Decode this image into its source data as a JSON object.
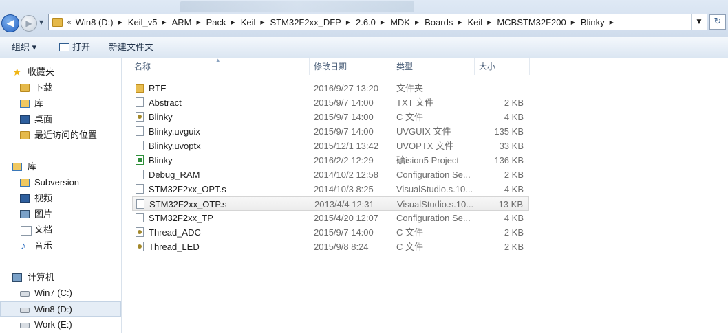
{
  "address": {
    "chevron": "«",
    "crumbs": [
      "Win8 (D:)",
      "Keil_v5",
      "ARM",
      "Pack",
      "Keil",
      "STM32F2xx_DFP",
      "2.6.0",
      "MDK",
      "Boards",
      "Keil",
      "MCBSTM32F200",
      "Blinky"
    ],
    "refresh_icon": "↻"
  },
  "toolbar": {
    "organize": "组织 ▾",
    "open": "打开",
    "new_folder": "新建文件夹"
  },
  "nav": {
    "favorites": {
      "label": "收藏夹",
      "icon": "star-icon",
      "items": [
        "下载",
        "库",
        "桌面",
        "最近访问的位置"
      ]
    },
    "libraries": {
      "label": "库",
      "items": [
        "Subversion",
        "视频",
        "图片",
        "文档",
        "音乐"
      ]
    },
    "computer": {
      "label": "计算机",
      "items": [
        "Win7 (C:)",
        "Win8 (D:)",
        "Work (E:)"
      ]
    }
  },
  "columns": {
    "name": "名称",
    "date": "修改日期",
    "type": "类型",
    "size": "大小"
  },
  "files": [
    {
      "name": "RTE",
      "date": "2016/9/27 13:20",
      "type": "文件夹",
      "size": "",
      "icon": "folder-icon"
    },
    {
      "name": "Abstract",
      "date": "2015/9/7 14:00",
      "type": "TXT 文件",
      "size": "2 KB",
      "icon": "text-file-icon"
    },
    {
      "name": "Blinky",
      "date": "2015/9/7 14:00",
      "type": "C 文件",
      "size": "4 KB",
      "icon": "c-file-icon"
    },
    {
      "name": "Blinky.uvguix",
      "date": "2015/9/7 14:00",
      "type": "UVGUIX 文件",
      "size": "135 KB",
      "icon": "generic-file-icon"
    },
    {
      "name": "Blinky.uvoptx",
      "date": "2015/12/1 13:42",
      "type": "UVOPTX 文件",
      "size": "33 KB",
      "icon": "generic-file-icon"
    },
    {
      "name": "Blinky",
      "date": "2016/2/2 12:29",
      "type": "礦ision5 Project",
      "size": "136 KB",
      "icon": "uvision-project-icon"
    },
    {
      "name": "Debug_RAM",
      "date": "2014/10/2 12:58",
      "type": "Configuration Se...",
      "size": "2 KB",
      "icon": "generic-file-icon"
    },
    {
      "name": "STM32F2xx_OPT.s",
      "date": "2014/10/3 8:25",
      "type": "VisualStudio.s.10...",
      "size": "4 KB",
      "icon": "generic-file-icon"
    },
    {
      "name": "STM32F2xx_OTP.s",
      "date": "2013/4/4 12:31",
      "type": "VisualStudio.s.10...",
      "size": "13 KB",
      "icon": "generic-file-icon"
    },
    {
      "name": "STM32F2xx_TP",
      "date": "2015/4/20 12:07",
      "type": "Configuration Se...",
      "size": "4 KB",
      "icon": "generic-file-icon"
    },
    {
      "name": "Thread_ADC",
      "date": "2015/9/7 14:00",
      "type": "C 文件",
      "size": "2 KB",
      "icon": "c-file-icon"
    },
    {
      "name": "Thread_LED",
      "date": "2015/9/8 8:24",
      "type": "C 文件",
      "size": "2 KB",
      "icon": "c-file-icon"
    }
  ],
  "selected_file_index": 8,
  "selected_nav_item": "Win8 (D:)"
}
